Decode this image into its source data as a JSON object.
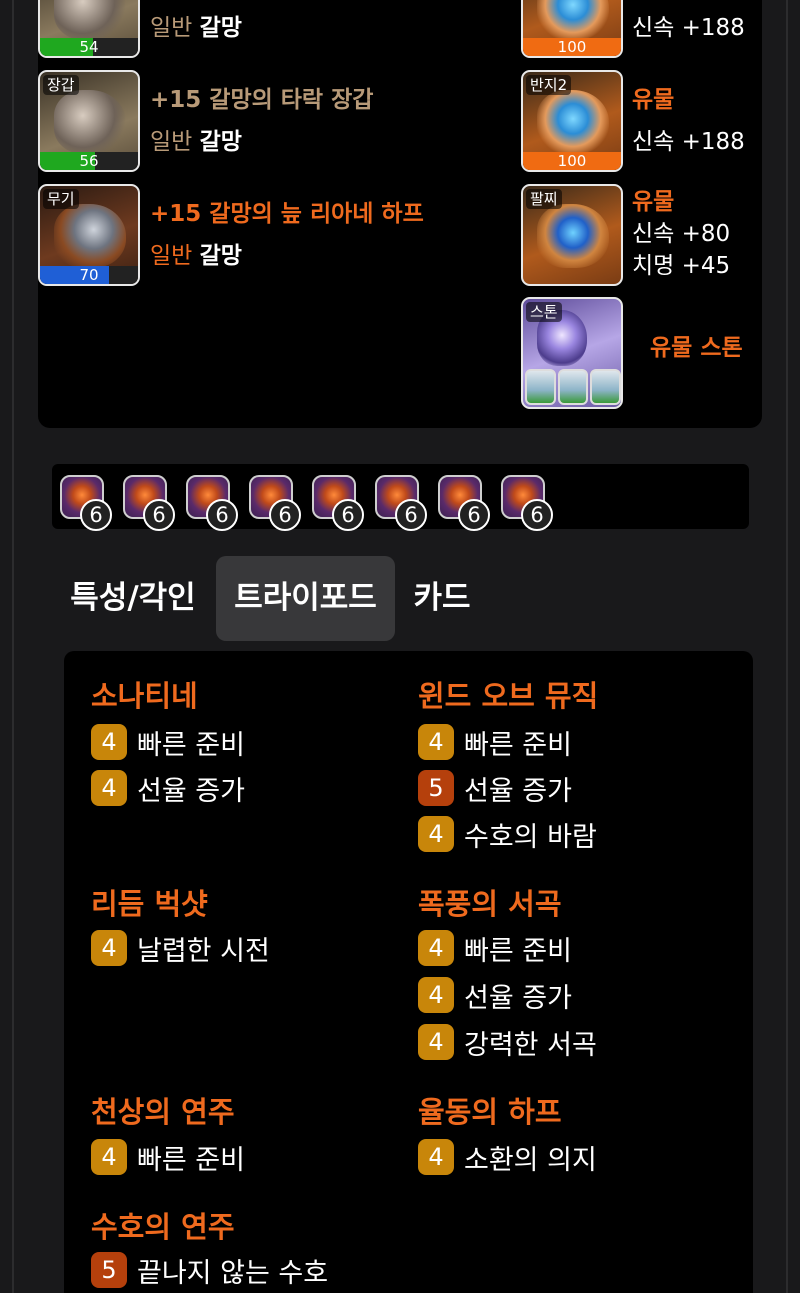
{
  "equipment": {
    "left_items": [
      {
        "slot_label": "",
        "quality": 54,
        "quality_color": "green",
        "name": "",
        "grade": "일반",
        "set": "갈망"
      },
      {
        "slot_label": "장갑",
        "quality": 56,
        "quality_color": "green",
        "name": "+15 갈망의 타락 장갑",
        "grade": "일반",
        "set": "갈망"
      },
      {
        "slot_label": "무기",
        "quality": 70,
        "quality_color": "blue",
        "name": "+15 갈망의 늪 리아네 하프",
        "grade": "일반",
        "set": "갈망"
      }
    ],
    "right_items": [
      {
        "slot_label": "",
        "quality": 100,
        "grade": "",
        "stats": [
          "신속 +188"
        ]
      },
      {
        "slot_label": "반지2",
        "quality": 100,
        "grade": "유물",
        "stats": [
          "신속 +188"
        ]
      },
      {
        "slot_label": "팔찌",
        "quality": null,
        "grade": "유물",
        "stats": [
          "신속 +80",
          "치명 +45"
        ]
      },
      {
        "slot_label": "스톤",
        "quality": null,
        "grade": "유물 스톤",
        "stats": []
      }
    ]
  },
  "gems": {
    "levels": [
      "6",
      "6",
      "6",
      "6",
      "6",
      "6",
      "6",
      "6"
    ]
  },
  "tabs": [
    {
      "label": "특성/각인",
      "active": false
    },
    {
      "label": "트라이포드",
      "active": true
    },
    {
      "label": "카드",
      "active": false
    }
  ],
  "tripods": {
    "left": [
      {
        "skill": "소나티네",
        "items": [
          {
            "level": "4",
            "name": "빠른 준비"
          },
          {
            "level": "4",
            "name": "선율 증가"
          }
        ]
      },
      {
        "skill": "리듬 벅샷",
        "items": [
          {
            "level": "4",
            "name": "날렵한 시전"
          }
        ]
      },
      {
        "skill": "천상의 연주",
        "items": [
          {
            "level": "4",
            "name": "빠른 준비"
          }
        ]
      },
      {
        "skill": "수호의 연주",
        "items": [
          {
            "level": "5",
            "name": "끝나지 않는 수호"
          }
        ]
      }
    ],
    "right": [
      {
        "skill": "윈드 오브 뮤직",
        "items": [
          {
            "level": "4",
            "name": "빠른 준비"
          },
          {
            "level": "5",
            "name": "선율 증가"
          },
          {
            "level": "4",
            "name": "수호의 바람"
          }
        ]
      },
      {
        "skill": "폭풍의 서곡",
        "items": [
          {
            "level": "4",
            "name": "빠른 준비"
          },
          {
            "level": "4",
            "name": "선율 증가"
          },
          {
            "level": "4",
            "name": "강력한 서곡"
          }
        ]
      },
      {
        "skill": "율동의 하프",
        "items": [
          {
            "level": "4",
            "name": "소환의 의지"
          }
        ]
      }
    ]
  },
  "colors": {
    "ancient_orange": "#ef6a1e",
    "legend_tan": "#b89a78",
    "tripod_gold": "#c8860a",
    "tripod_max": "#b5400c",
    "quality_green": "#1fa81f",
    "quality_blue": "#1f5fd6",
    "quality_orange": "#f06b12"
  }
}
